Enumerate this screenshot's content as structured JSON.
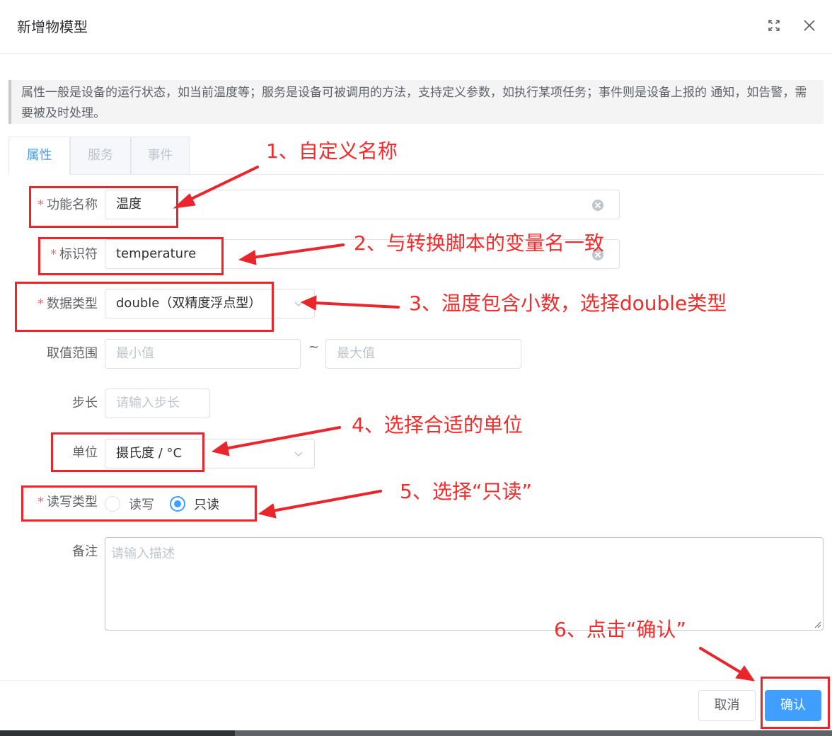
{
  "dialog": {
    "title": "新增物模型",
    "tip": "属性一般是设备的运行状态，如当前温度等；服务是设备可被调用的方法，支持定义参数，如执行某项任务；事件则是设备上报的 通知，如告警，需要被及时处理。"
  },
  "tabs": [
    {
      "label": "属性",
      "active": true
    },
    {
      "label": "服务",
      "active": false
    },
    {
      "label": "事件",
      "active": false
    }
  ],
  "form": {
    "name": {
      "label": "功能名称",
      "value": "温度",
      "required": true
    },
    "identifier": {
      "label": "标识符",
      "value": "temperature",
      "required": true
    },
    "data_type": {
      "label": "数据类型",
      "value": "double（双精度浮点型）",
      "required": true
    },
    "range": {
      "label": "取值范围",
      "min_placeholder": "最小值",
      "max_placeholder": "最大值",
      "separator": "~"
    },
    "step": {
      "label": "步长",
      "placeholder": "请输入步长"
    },
    "unit": {
      "label": "单位",
      "value": "摄氏度 / °C"
    },
    "rw_type": {
      "label": "读写类型",
      "required": true,
      "options": [
        "读写",
        "只读"
      ],
      "selected": "只读"
    },
    "remark": {
      "label": "备注",
      "placeholder": "请输入描述"
    }
  },
  "footer": {
    "cancel_label": "取消",
    "confirm_label": "确认"
  },
  "annotations": [
    "1、自定义名称",
    "2、与转换脚本的变量名一致",
    "3、温度包含小数，选择double类型",
    "4、选择合适的单位",
    "5、选择“只读”",
    "6、点击“确认”"
  ],
  "colors": {
    "primary": "#409eff",
    "annotation": "#e8262c",
    "required": "#f56c6c"
  }
}
